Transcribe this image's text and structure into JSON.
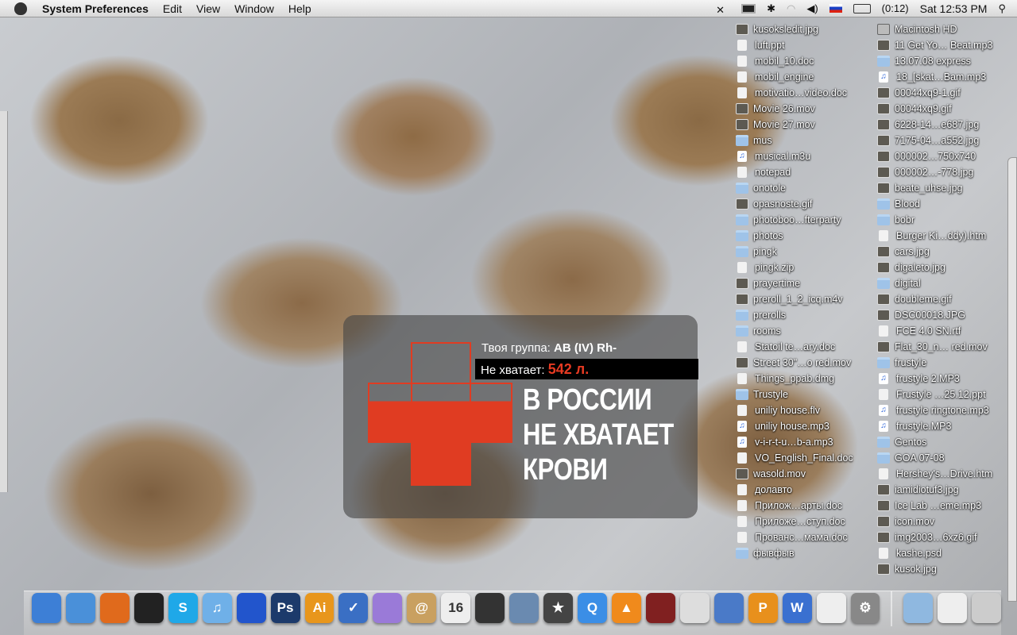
{
  "menubar": {
    "app": "System Preferences",
    "items": [
      "Edit",
      "View",
      "Window",
      "Help"
    ],
    "battery": "(0:12)",
    "clock": "Sat 12:53 PM"
  },
  "widget": {
    "group_label": "Твоя группа:",
    "group_value": "AB (IV) Rh-",
    "lack_label": "Не хватает:",
    "lack_value": "542 л.",
    "headline": [
      "В РОССИИ",
      "НЕ ХВАТАЕТ",
      "КРОВИ"
    ],
    "accent": "#e03c22"
  },
  "desktop": {
    "col1": [
      [
        "kusoksledit.jpg",
        "img"
      ],
      [
        "luft.ppt",
        "doc"
      ],
      [
        "mobil_10.doc",
        "doc"
      ],
      [
        "mobil_engine",
        "doc"
      ],
      [
        "motivatio…video.doc",
        "doc"
      ],
      [
        "Movie 26.mov",
        "img"
      ],
      [
        "Movie 27.mov",
        "img"
      ],
      [
        "mus",
        "folder"
      ],
      [
        "musical.m3u",
        "audio"
      ],
      [
        "notepad",
        "doc"
      ],
      [
        "onotole",
        "folder"
      ],
      [
        "opasnoste.gif",
        "img"
      ],
      [
        "photoboo…fterparty",
        "folder"
      ],
      [
        "photos",
        "folder"
      ],
      [
        "pingk",
        "folder"
      ],
      [
        "pingk.zip",
        "doc"
      ],
      [
        "prayertime",
        "img"
      ],
      [
        "preroll_1_2_icq.m4v",
        "img"
      ],
      [
        "prerolls",
        "folder"
      ],
      [
        "rooms",
        "folder"
      ],
      [
        "Statoil te…ary.doc",
        "doc"
      ],
      [
        "Street 30\"…o red.mov",
        "img"
      ],
      [
        "Things_ppab.dmg",
        "doc"
      ],
      [
        "Trustyle",
        "folder"
      ],
      [
        "uniliy house.flv",
        "doc"
      ],
      [
        "uniliy house.mp3",
        "audio"
      ],
      [
        "v-i-r-t-u…b-a.mp3",
        "audio"
      ],
      [
        "VO_English_Final.doc",
        "doc"
      ],
      [
        "wasold.mov",
        "img"
      ],
      [
        "долавто",
        "doc"
      ],
      [
        "Прилож…арты.doc",
        "doc"
      ],
      [
        "Приложе…ступ.doc",
        "doc"
      ],
      [
        "Прованс…мама.doc",
        "doc"
      ],
      [
        "фывфыв",
        "folder"
      ]
    ],
    "col2": [
      [
        "Macintosh HD",
        "disk"
      ],
      [
        "11 Get Yo… Beat.mp3",
        "img"
      ],
      [
        "13.07.08 express",
        "folder"
      ],
      [
        "18_[skat…Bam.mp3",
        "audio"
      ],
      [
        "00044xq9-1.gif",
        "img"
      ],
      [
        "00044xq9.gif",
        "img"
      ],
      [
        "6228-14…e687.jpg",
        "img"
      ],
      [
        "7175-04…a552.jpg",
        "img"
      ],
      [
        "000002…750x740",
        "img"
      ],
      [
        "000002…-778.jpg",
        "img"
      ],
      [
        "beate_uhse.jpg",
        "img"
      ],
      [
        "Blood",
        "folder"
      ],
      [
        "bobr",
        "folder"
      ],
      [
        "Burger Ki…ddy).htm",
        "doc"
      ],
      [
        "cars.jpg",
        "img"
      ],
      [
        "digaleto.jpg",
        "img"
      ],
      [
        "digital",
        "folder"
      ],
      [
        "doubleme.gif",
        "img"
      ],
      [
        "DSC00018.JPG",
        "img"
      ],
      [
        "FCE 4.0 SN.rtf",
        "doc"
      ],
      [
        "Flat_30_n… red.mov",
        "img"
      ],
      [
        "frustyle",
        "folder"
      ],
      [
        "frustyle 2.MP3",
        "audio"
      ],
      [
        "Frustyle …25.12.ppt",
        "doc"
      ],
      [
        "frustyle ringtone.mp3",
        "audio"
      ],
      [
        "frustyle.MP3",
        "audio"
      ],
      [
        "Gentos",
        "folder"
      ],
      [
        "GOA 07-08",
        "folder"
      ],
      [
        "Hershey's…Drive.htm",
        "doc"
      ],
      [
        "iamidiotuf3.jpg",
        "img"
      ],
      [
        "Ice Lab …eme.mp3",
        "img"
      ],
      [
        "icon.mov",
        "img"
      ],
      [
        "img2003…6xz6.gif",
        "img"
      ],
      [
        "kashe.psd",
        "doc"
      ],
      [
        "kusok.jpg",
        "img"
      ]
    ]
  },
  "dock": [
    [
      "finder",
      "#3d7fd6",
      ""
    ],
    [
      "safari",
      "#4a90d9",
      ""
    ],
    [
      "firefox",
      "#e06a1c",
      ""
    ],
    [
      "adium",
      "#222",
      ""
    ],
    [
      "skype",
      "#1fa8e8",
      "S"
    ],
    [
      "itunes",
      "#6fb0e8",
      "♫"
    ],
    [
      "cyberduck",
      "#2255cc",
      ""
    ],
    [
      "photoshop",
      "#1c3a6b",
      "Ps"
    ],
    [
      "illustrator",
      "#e8961c",
      "Ai"
    ],
    [
      "things",
      "#3a6fc4",
      "✓"
    ],
    [
      "ichat",
      "#9a7ad8",
      ""
    ],
    [
      "address-book",
      "#c9a060",
      "@"
    ],
    [
      "ical",
      "#eee",
      "16"
    ],
    [
      "burn",
      "#333",
      ""
    ],
    [
      "iphoto",
      "#6a8ab0",
      ""
    ],
    [
      "imovie",
      "#444",
      "★"
    ],
    [
      "quicktime",
      "#3b8ee6",
      "Q"
    ],
    [
      "vlc",
      "#f08a1c",
      "▲"
    ],
    [
      "final-cut",
      "#802020",
      ""
    ],
    [
      "pencil",
      "#ddd",
      ""
    ],
    [
      "preview",
      "#4a7ac8",
      ""
    ],
    [
      "pages",
      "#e8901c",
      "P"
    ],
    [
      "word",
      "#3a70d0",
      "W"
    ],
    [
      "textedit",
      "#eee",
      ""
    ],
    [
      "system-preferences",
      "#888",
      "⚙"
    ],
    [
      "folder",
      "#8fb8e0",
      ""
    ],
    [
      "document",
      "#eee",
      ""
    ],
    [
      "trash",
      "#ccc",
      ""
    ]
  ]
}
